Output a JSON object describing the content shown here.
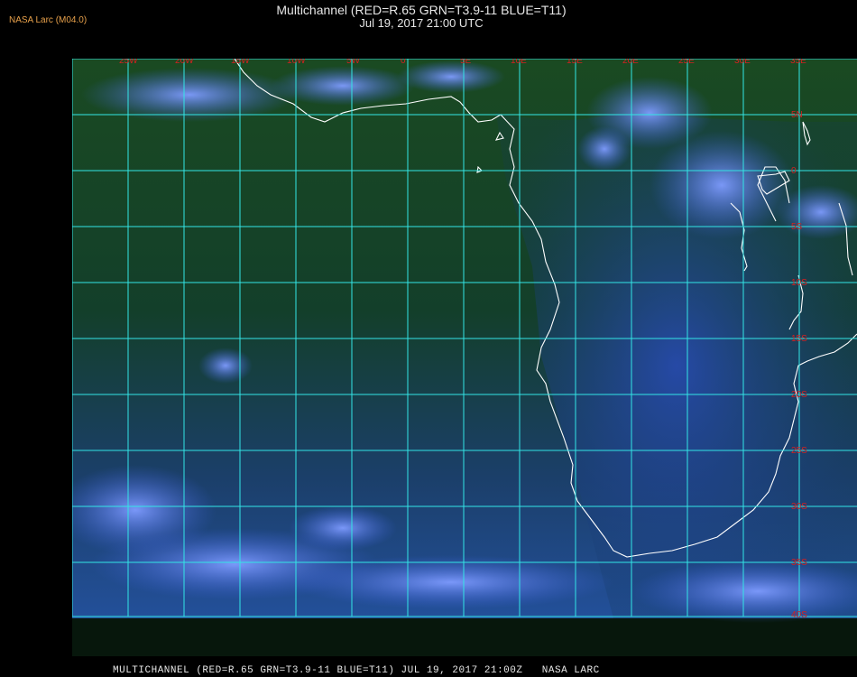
{
  "corner_label": "NASA Larc (M04.0)",
  "title_line1": "Multichannel (RED=R.65 GRN=T3.9-11 BLUE=T11)",
  "title_line2": "Jul 19, 2017 21:00 UTC",
  "footer": "MULTICHANNEL (RED=R.65 GRN=T3.9-11 BLUE=T11) JUL 19, 2017 21:00Z   NASA LARC",
  "longitude_labels": [
    "25W",
    "20W",
    "15W",
    "10W",
    "5W",
    "0",
    "5E",
    "10E",
    "15E",
    "20E",
    "25E",
    "30E",
    "35E"
  ],
  "latitude_labels": [
    "5N",
    "0",
    "5S",
    "10S",
    "15S",
    "20S",
    "25S",
    "30S",
    "35S",
    "40S"
  ],
  "colors": {
    "grid": "#33e6e6",
    "grid_label": "#d42020",
    "coastline": "#ffffff",
    "ocean_dark": "#0f3a18",
    "cloud": "#4f6fe6"
  }
}
